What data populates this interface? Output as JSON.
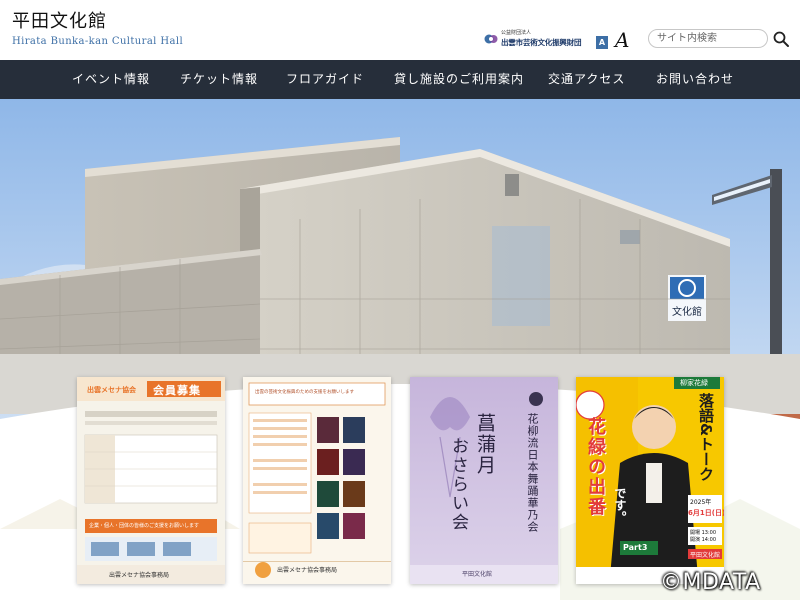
{
  "header": {
    "title": "平田文化館",
    "subtitle": "Hirata Bunka-kan Cultural Hall",
    "foundation": {
      "small_label": "公益財団法人",
      "name": "出雲市芸術文化振興財団"
    },
    "font_size_small": "A",
    "font_size_large": "A",
    "search": {
      "placeholder": "サイト内検索"
    }
  },
  "nav": {
    "items": [
      {
        "label": "イベント情報"
      },
      {
        "label": "チケット情報"
      },
      {
        "label": "フロアガイド"
      },
      {
        "label": "貸し施設のご利用案内"
      },
      {
        "label": "交通アクセス"
      },
      {
        "label": "お問い合わせ"
      }
    ]
  },
  "hero": {
    "building_sign": "文化館"
  },
  "posters": [
    {
      "heading_left": "出雲メセナ協会",
      "heading_right": "会員募集",
      "footer": "出雲メセナ協会事務局",
      "sub_label": "企業・個人・団体の皆様のご支援をお願いします"
    },
    {
      "heading": "出雲の芸術文化振興のための支援をお願いします",
      "footer": "出雲メセナ協会事務局"
    },
    {
      "title_line1": "菖蒲月",
      "title_line2": "おさらい会",
      "side_title": "花柳流日本舞踊華乃会",
      "venue": "平田文化館"
    },
    {
      "badge": "柳家花緑",
      "title_main": "花緑の出番",
      "title_suffix": "です。",
      "side": "落語&トーク",
      "part": "Part3",
      "year": "2025年",
      "date": "6月1日(日)",
      "time1": "開場 13:00",
      "time2": "開演 14:00",
      "venue": "平田文化館"
    }
  ],
  "watermark": "©MDATA",
  "colors": {
    "nav_bg": "#262e3a",
    "accent_blue": "#3d6fa6",
    "poster1_orange": "#e8742a",
    "poster3_lavender": "#cfc1e0",
    "poster4_yellow": "#f7c800"
  }
}
